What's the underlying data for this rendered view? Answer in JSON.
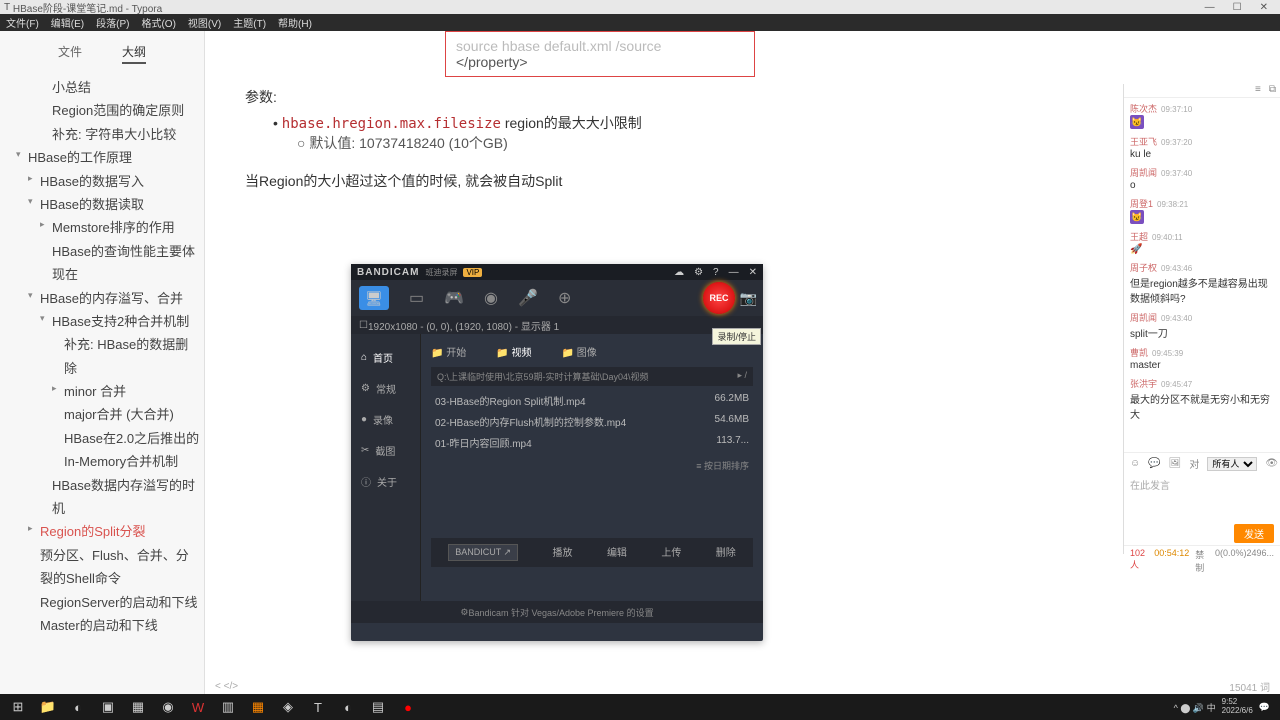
{
  "titlebar": {
    "title": "HBase阶段-课堂笔记.md - Typora",
    "app_hint": "T"
  },
  "menubar": [
    "文件(F)",
    "编辑(E)",
    "段落(P)",
    "格式(O)",
    "视图(V)",
    "主题(T)",
    "帮助(H)"
  ],
  "sidebar": {
    "tabs": {
      "file": "文件",
      "outline": "大纲"
    },
    "items": [
      {
        "lvl": 3,
        "label": "小总结"
      },
      {
        "lvl": 3,
        "label": "Region范围的确定原则"
      },
      {
        "lvl": 3,
        "label": "补充: 字符串大小比较"
      },
      {
        "lvl": 1,
        "label": "HBase的工作原理",
        "arrow": "▾"
      },
      {
        "lvl": 2,
        "label": "HBase的数据写入",
        "arrow": "▸"
      },
      {
        "lvl": 2,
        "label": "HBase的数据读取",
        "arrow": "▾"
      },
      {
        "lvl": 3,
        "label": "Memstore排序的作用",
        "arrow": "▸"
      },
      {
        "lvl": 3,
        "label": "HBase的查询性能主要体现在"
      },
      {
        "lvl": 2,
        "label": "HBase的内存溢写、合并",
        "arrow": "▾"
      },
      {
        "lvl": 3,
        "label": "HBase支持2种合并机制",
        "arrow": "▾"
      },
      {
        "lvl": 4,
        "label": "补充: HBase的数据删除"
      },
      {
        "lvl": 4,
        "label": "minor 合并",
        "arrow": "▸"
      },
      {
        "lvl": 4,
        "label": "major合并 (大合并)"
      },
      {
        "lvl": 4,
        "label": "HBase在2.0之后推出的In-Memory合并机制"
      },
      {
        "lvl": 3,
        "label": "HBase数据内存溢写的时机"
      },
      {
        "lvl": 2,
        "label": "Region的Split分裂",
        "sel": true,
        "arrow": "▸"
      },
      {
        "lvl": 2,
        "label": "预分区、Flush、合并、分裂的Shell命令"
      },
      {
        "lvl": 2,
        "label": "RegionServer的启动和下线"
      },
      {
        "lvl": 2,
        "label": "Master的启动和下线"
      }
    ]
  },
  "content": {
    "codebox": {
      "line1": "source  hbase default.xml  /source",
      "line2": "</property>"
    },
    "params_label": "参数:",
    "prop": "hbase.hregion.max.filesize",
    "prop_desc": " region的最大大小限制",
    "default_label": "默认值: ",
    "default_val": "10737418240  (10个GB)",
    "split_line": "当Region的大小超过这个值的时候, 就会被自动Split"
  },
  "bandicam": {
    "brand": "BANDICAM",
    "brand_sub": "班迪录屏",
    "vip": "VIP",
    "rec": "REC",
    "tooltip": "录制/停止",
    "resolution": "1920x1080 - (0, 0), (1920, 1080) - 显示器 1",
    "nav": [
      "首页",
      "常规",
      "录像",
      "截图",
      "关于"
    ],
    "tabs": [
      "开始",
      "视频",
      "图像"
    ],
    "path": "Q:\\上课临时使用\\北京59期-实时计算基础\\Day04\\视频",
    "files": [
      {
        "name": "03-HBase的Region Split机制.mp4",
        "size": "66.2MB"
      },
      {
        "name": "02-HBase的内存Flush机制的控制参数.mp4",
        "size": "54.6MB"
      },
      {
        "name": "01-昨日内容回顾.mp4",
        "size": "113.7..."
      }
    ],
    "sort": "按日期排序",
    "cut": "BANDICUT ↗",
    "btns": [
      "播放",
      "编辑",
      "上传",
      "删除"
    ],
    "footer": "Bandicam 针对 Vegas/Adobe Premiere 的设置"
  },
  "chat": {
    "msgs": [
      {
        "u": "陈次杰",
        "t": "09:37:10",
        "av": "😼"
      },
      {
        "u": "王亚飞",
        "t": "09:37:20",
        "tx": "ku le"
      },
      {
        "u": "周凯闻",
        "t": "09:37:40",
        "tx": "o"
      },
      {
        "u": "周登1",
        "t": "09:38:21",
        "av": "😼"
      },
      {
        "u": "王超",
        "t": "09:40:11",
        "tx": "🚀"
      },
      {
        "u": "周子权",
        "t": "09:43:46",
        "tx": "但是region越多不是越容易出现数据倾斜吗?"
      },
      {
        "u": "周凯闻",
        "t": "09:43:40",
        "tx": "split一刀"
      },
      {
        "u": "曹凯",
        "t": "09:45:39",
        "tx": "master"
      },
      {
        "u": "张洪宇",
        "t": "09:45:47",
        "tx": "最大的分区不就是无穷小和无穷大"
      }
    ],
    "to_label": "对",
    "to": "所有人",
    "placeholder": "在此发言",
    "send": "发送",
    "count": "102人",
    "dur": "00:54:12",
    "ctrl": "禁制",
    "net": "0(0.0%)2496..."
  },
  "status": {
    "left": "< </>",
    "words": "15041 词"
  },
  "tray": {
    "time": "9:52",
    "date": "2022/6/6"
  }
}
